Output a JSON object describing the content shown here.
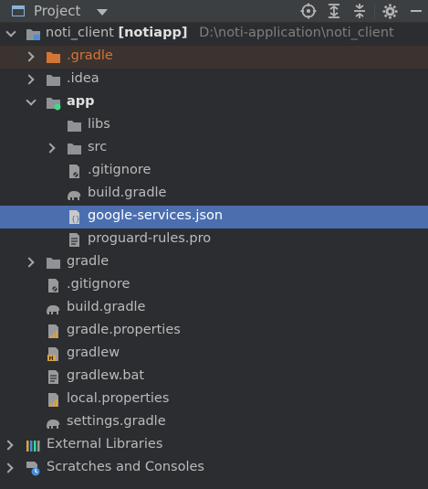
{
  "header": {
    "title": "Project",
    "tools": [
      "locate-icon",
      "expand-all-icon",
      "collapse-all-icon",
      "gear-icon",
      "hide-icon"
    ]
  },
  "tree": {
    "root": {
      "name": "noti_client",
      "module": "[notiapp]",
      "path": "D:\\noti-application\\noti_client"
    },
    "gradle_dir": ".gradle",
    "idea_dir": ".idea",
    "app": {
      "name": "app",
      "libs": "libs",
      "src": "src",
      "gitignore": ".gitignore",
      "build_gradle": "build.gradle",
      "google_services": "google-services.json",
      "proguard": "proguard-rules.pro"
    },
    "gradle": "gradle",
    "gitignore": ".gitignore",
    "build_gradle": "build.gradle",
    "gradle_properties": "gradle.properties",
    "gradlew": "gradlew",
    "gradlew_bat": "gradlew.bat",
    "local_properties": "local.properties",
    "settings_gradle": "settings.gradle",
    "external_libraries": "External Libraries",
    "scratches": "Scratches and Consoles"
  },
  "colors": {
    "selection": "#4b6eaf",
    "excluded_folder": "#d27536",
    "folder": "#8f9297",
    "background": "#2b2d30"
  }
}
